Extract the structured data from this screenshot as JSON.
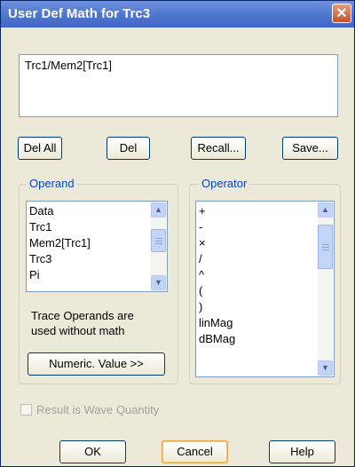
{
  "window": {
    "title": "User Def Math for Trc3",
    "close_label": "✕"
  },
  "formula": {
    "value": "Trc1/Mem2[Trc1]"
  },
  "top_buttons": {
    "del_all": "Del All",
    "del": "Del",
    "recall": "Recall...",
    "save": "Save..."
  },
  "operand": {
    "label": "Operand",
    "items": [
      "Data",
      "Trc1",
      "Mem2[Trc1]",
      "Trc3",
      "Pi"
    ],
    "note_line1": "Trace Operands are",
    "note_line2": "used without math",
    "numeric_button": "Numeric. Value >>"
  },
  "operator": {
    "label": "Operator",
    "items": [
      "+",
      "-",
      "×",
      "/",
      "^",
      "(",
      ")",
      "linMag",
      "dBMag"
    ]
  },
  "result_checkbox": {
    "label": "Result is Wave Quantity",
    "checked": false,
    "enabled": false
  },
  "bottom_buttons": {
    "ok": "OK",
    "cancel": "Cancel",
    "help": "Help"
  }
}
